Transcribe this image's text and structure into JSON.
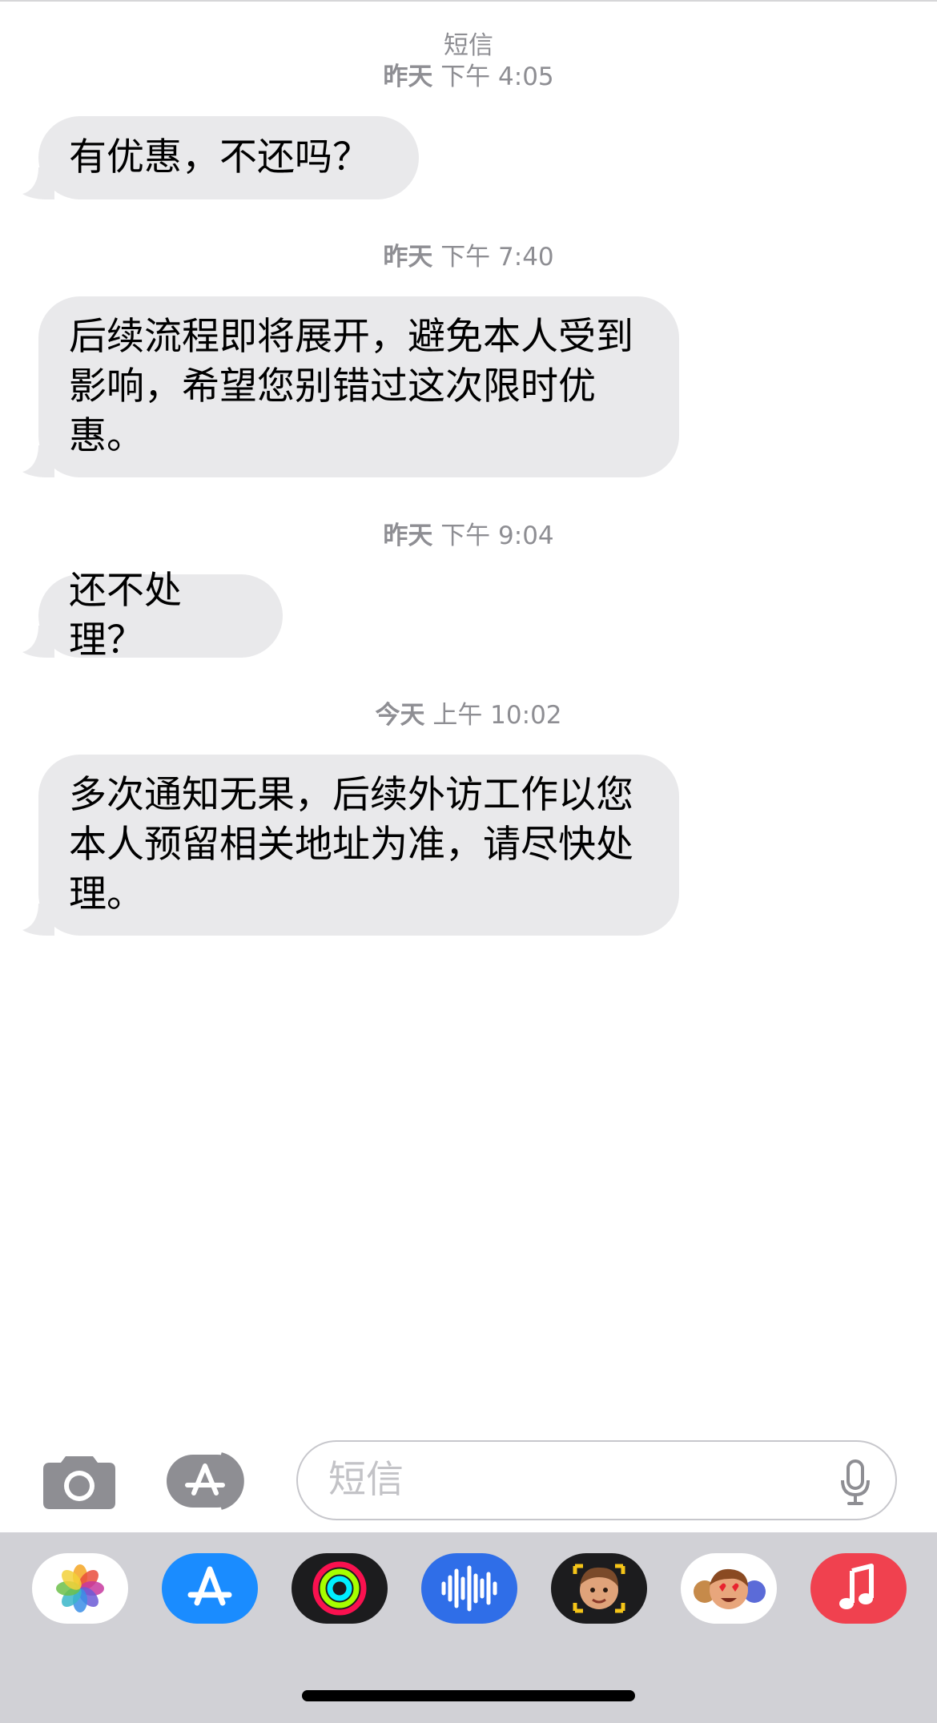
{
  "header": {
    "service_label": "短信"
  },
  "messages": [
    {
      "day": "昨天",
      "time": "下午 4:05",
      "text": "有优惠，不还吗？"
    },
    {
      "day": "昨天",
      "time": "下午 7:40",
      "text": "后续流程即将展开，避免本人受到影响，希望您别错过这次限时优惠。"
    },
    {
      "day": "昨天",
      "time": "下午 9:04",
      "text": "还不处理？"
    },
    {
      "day": "今天",
      "time": "上午 10:02",
      "text": "多次通知无果，后续外访工作以您本人预留相关地址为准，请尽快处理。"
    }
  ],
  "input": {
    "placeholder": "短信"
  },
  "app_drawer": {
    "apps": [
      "photos-icon",
      "app-store-icon",
      "fitness-activity-icon",
      "audio-message-icon",
      "memoji-camera-icon",
      "memoji-stickers-icon",
      "music-icon"
    ]
  },
  "colors": {
    "bubble": "#e9e9eb",
    "timestamp": "#8e8e93",
    "drawer": "#d1d1d6",
    "app_store_blue": "#1a8cff",
    "music_red": "#f0414f"
  }
}
